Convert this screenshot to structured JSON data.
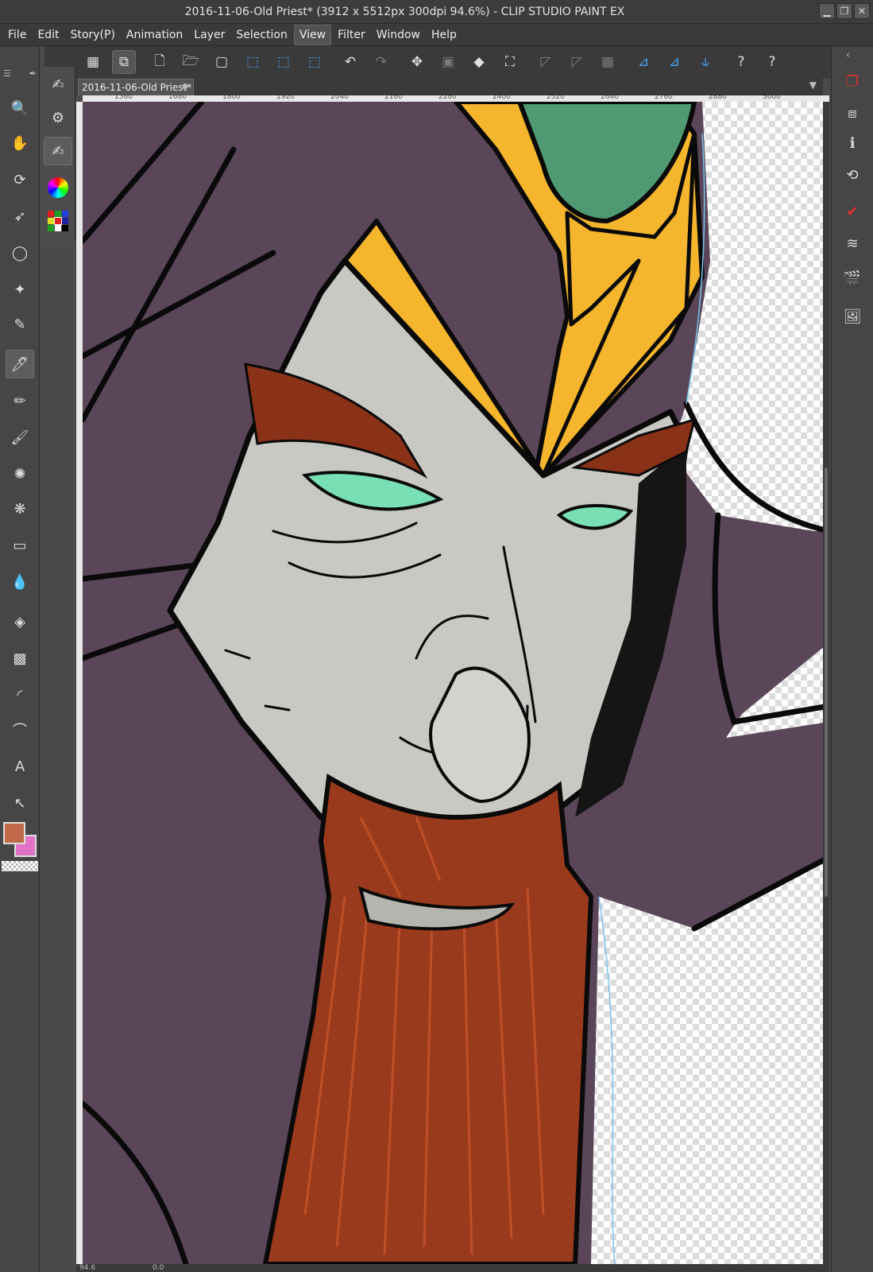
{
  "window": {
    "title": "2016-11-06-Old Priest* (3912 x 5512px 300dpi 94.6%)  - CLIP STUDIO PAINT EX",
    "minimize_glyph": "▁",
    "maximize_glyph": "❐",
    "close_glyph": "✕"
  },
  "menu": {
    "items": [
      {
        "label": "File"
      },
      {
        "label": "Edit"
      },
      {
        "label": "Story(P)"
      },
      {
        "label": "Animation"
      },
      {
        "label": "Layer"
      },
      {
        "label": "Selection"
      },
      {
        "label": "View"
      },
      {
        "label": "Filter"
      },
      {
        "label": "Window"
      },
      {
        "label": "Help"
      }
    ],
    "active": "View"
  },
  "toolbar": {
    "icons": [
      "grid-icon",
      "screen-icon",
      "new-file-icon",
      "open-folder-icon",
      "save-icon",
      "select-layer-icon",
      "select-layer-alt-icon",
      "select-layer-alt2-icon",
      "undo-icon",
      "redo-icon",
      "transform-points-icon",
      "selection-box-icon",
      "fill-icon",
      "crop-icon",
      "ruler-off-icon",
      "ruler-off2-icon",
      "grid-off-icon",
      "perspective-ruler-icon",
      "curve-ruler-icon",
      "snap-ruler-icon",
      "help-icon",
      "help-alt-icon"
    ],
    "glyphs": [
      "▦",
      "⧉",
      "🗋",
      "🗁",
      "▢",
      "⬚",
      "⬚",
      "⬚",
      "↶",
      "↷",
      "✥",
      "▣",
      "◆",
      "⛶",
      "◸",
      "◸",
      "▦",
      "⊿",
      "⊿",
      "⫝",
      "?",
      "?"
    ]
  },
  "document": {
    "tab_label": "2016-11-06-Old Priest*",
    "tab_dot": "●",
    "dropdown_glyph": "▼"
  },
  "ruler": {
    "top_labels": [
      "1560",
      "1680",
      "1800",
      "1920",
      "2040",
      "2160",
      "2280",
      "2400",
      "2520",
      "2640",
      "2760",
      "2880",
      "3000"
    ]
  },
  "status": {
    "zoom": "94.6",
    "angle": "0.0"
  },
  "colors": {
    "main": "#c16a4a",
    "sub": "#e272c8",
    "robe": "#5a4658",
    "gold": "#f5b52c",
    "gem": "#4f9a72",
    "skin": "#c8c9c3",
    "beard": "#9a3a1c",
    "eye": "#78e0b4"
  },
  "left_tools": [
    "zoom-icon",
    "hand-icon",
    "rotate-icon",
    "move-icon",
    "lasso-icon",
    "magic-wand-icon",
    "eyedropper-icon",
    "pen-icon",
    "pencil-icon",
    "brush-icon",
    "airbrush-icon",
    "decoration-icon",
    "eraser-icon",
    "blend-icon",
    "fill-bucket-icon",
    "gradient-icon",
    "figure-icon",
    "curve-icon",
    "text-icon",
    "line-correct-icon"
  ],
  "left_glyphs": [
    "🔍",
    "✋",
    "⟳",
    "➶",
    "◯",
    "✦",
    "✎",
    "🖊",
    "✏",
    "🖌",
    "✺",
    "❋",
    "▭",
    "💧",
    "◈",
    "▩",
    "◜",
    "⌒",
    "A",
    "↖"
  ],
  "right_panels": [
    "layer-property-icon",
    "tone-icon",
    "info-icon",
    "auto-action-icon",
    "check-icon",
    "layers-icon",
    "animation-icon",
    "material-icon"
  ],
  "right_glyphs": [
    "❐",
    "⧈",
    "ℹ",
    "⟲",
    "✔",
    "≋",
    "🎬",
    "🖼"
  ]
}
